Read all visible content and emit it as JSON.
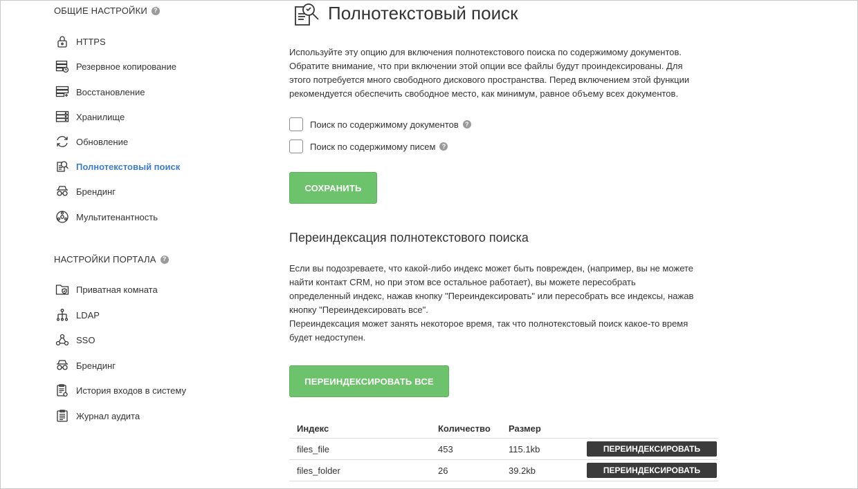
{
  "sidebar": {
    "general_title": "ОБЩИЕ НАСТРОЙКИ",
    "general_items": [
      {
        "label": "HTTPS",
        "icon": "lock-icon"
      },
      {
        "label": "Резервное копирование",
        "icon": "backup-icon"
      },
      {
        "label": "Восстановление",
        "icon": "restore-icon"
      },
      {
        "label": "Хранилище",
        "icon": "storage-icon"
      },
      {
        "label": "Обновление",
        "icon": "update-icon"
      },
      {
        "label": "Полнотекстовый поиск",
        "icon": "fulltext-search-icon",
        "active": true
      },
      {
        "label": "Брендинг",
        "icon": "branding-icon"
      },
      {
        "label": "Мультитенантность",
        "icon": "multitenancy-icon"
      }
    ],
    "portal_title": "НАСТРОЙКИ ПОРТАЛА",
    "portal_items": [
      {
        "label": "Приватная комната",
        "icon": "private-room-icon"
      },
      {
        "label": "LDAP",
        "icon": "ldap-icon"
      },
      {
        "label": "SSO",
        "icon": "sso-icon"
      },
      {
        "label": "Брендинг",
        "icon": "branding-icon"
      },
      {
        "label": "История входов в систему",
        "icon": "login-history-icon"
      },
      {
        "label": "Журнал аудита",
        "icon": "audit-log-icon"
      }
    ],
    "help_glyph": "?"
  },
  "main": {
    "title": "Полнотекстовый поиск",
    "description": [
      "Используйте эту опцию для включения полнотекстового поиска по содержимому документов.",
      "Обратите внимание, что при включении этой опции все файлы будут проиндексированы. Для",
      "этого потребуется много свободного дискового пространства. Перед включением этой функции",
      "рекомендуется обеспечить свободное место, как минимум, равное объему всех документов."
    ],
    "checkbox_documents": "Поиск по содержимому документов",
    "checkbox_mail": "Поиск по содержимому писем",
    "save_button": "СОХРАНИТЬ",
    "reindex_title": "Переиндексация полнотекстового поиска",
    "reindex_description": [
      "Если вы подозреваете, что какой-либо индекс может быть поврежден, (например, вы не можете",
      "найти контакт CRM, но при этом все остальное работает), вы можете пересобрать",
      "определенный индекс, нажав кнопку \"Переиндексировать\" или пересобрать все индексы, нажав",
      "кнопку \"Переиндексировать все\".",
      "Переиндексация может занять некоторое время, так что полнотекстовый поиск какое-то время",
      "будет недоступен."
    ],
    "reindex_all_button": "ПЕРЕИНДЕКСИРОВАТЬ ВСЕ",
    "table": {
      "headers": [
        "Индекс",
        "Количество",
        "Размер"
      ],
      "rows": [
        {
          "name": "files_file",
          "count": "453",
          "size": "115.1kb",
          "action": "ПЕРЕИНДЕКСИРОВАТЬ"
        },
        {
          "name": "files_folder",
          "count": "26",
          "size": "39.2kb",
          "action": "ПЕРЕИНДЕКСИРОВАТЬ"
        }
      ]
    }
  },
  "colors": {
    "accent_blue": "#3b7cd2",
    "green_button": "#6cc36b",
    "dark_button": "#3b3b3b"
  }
}
